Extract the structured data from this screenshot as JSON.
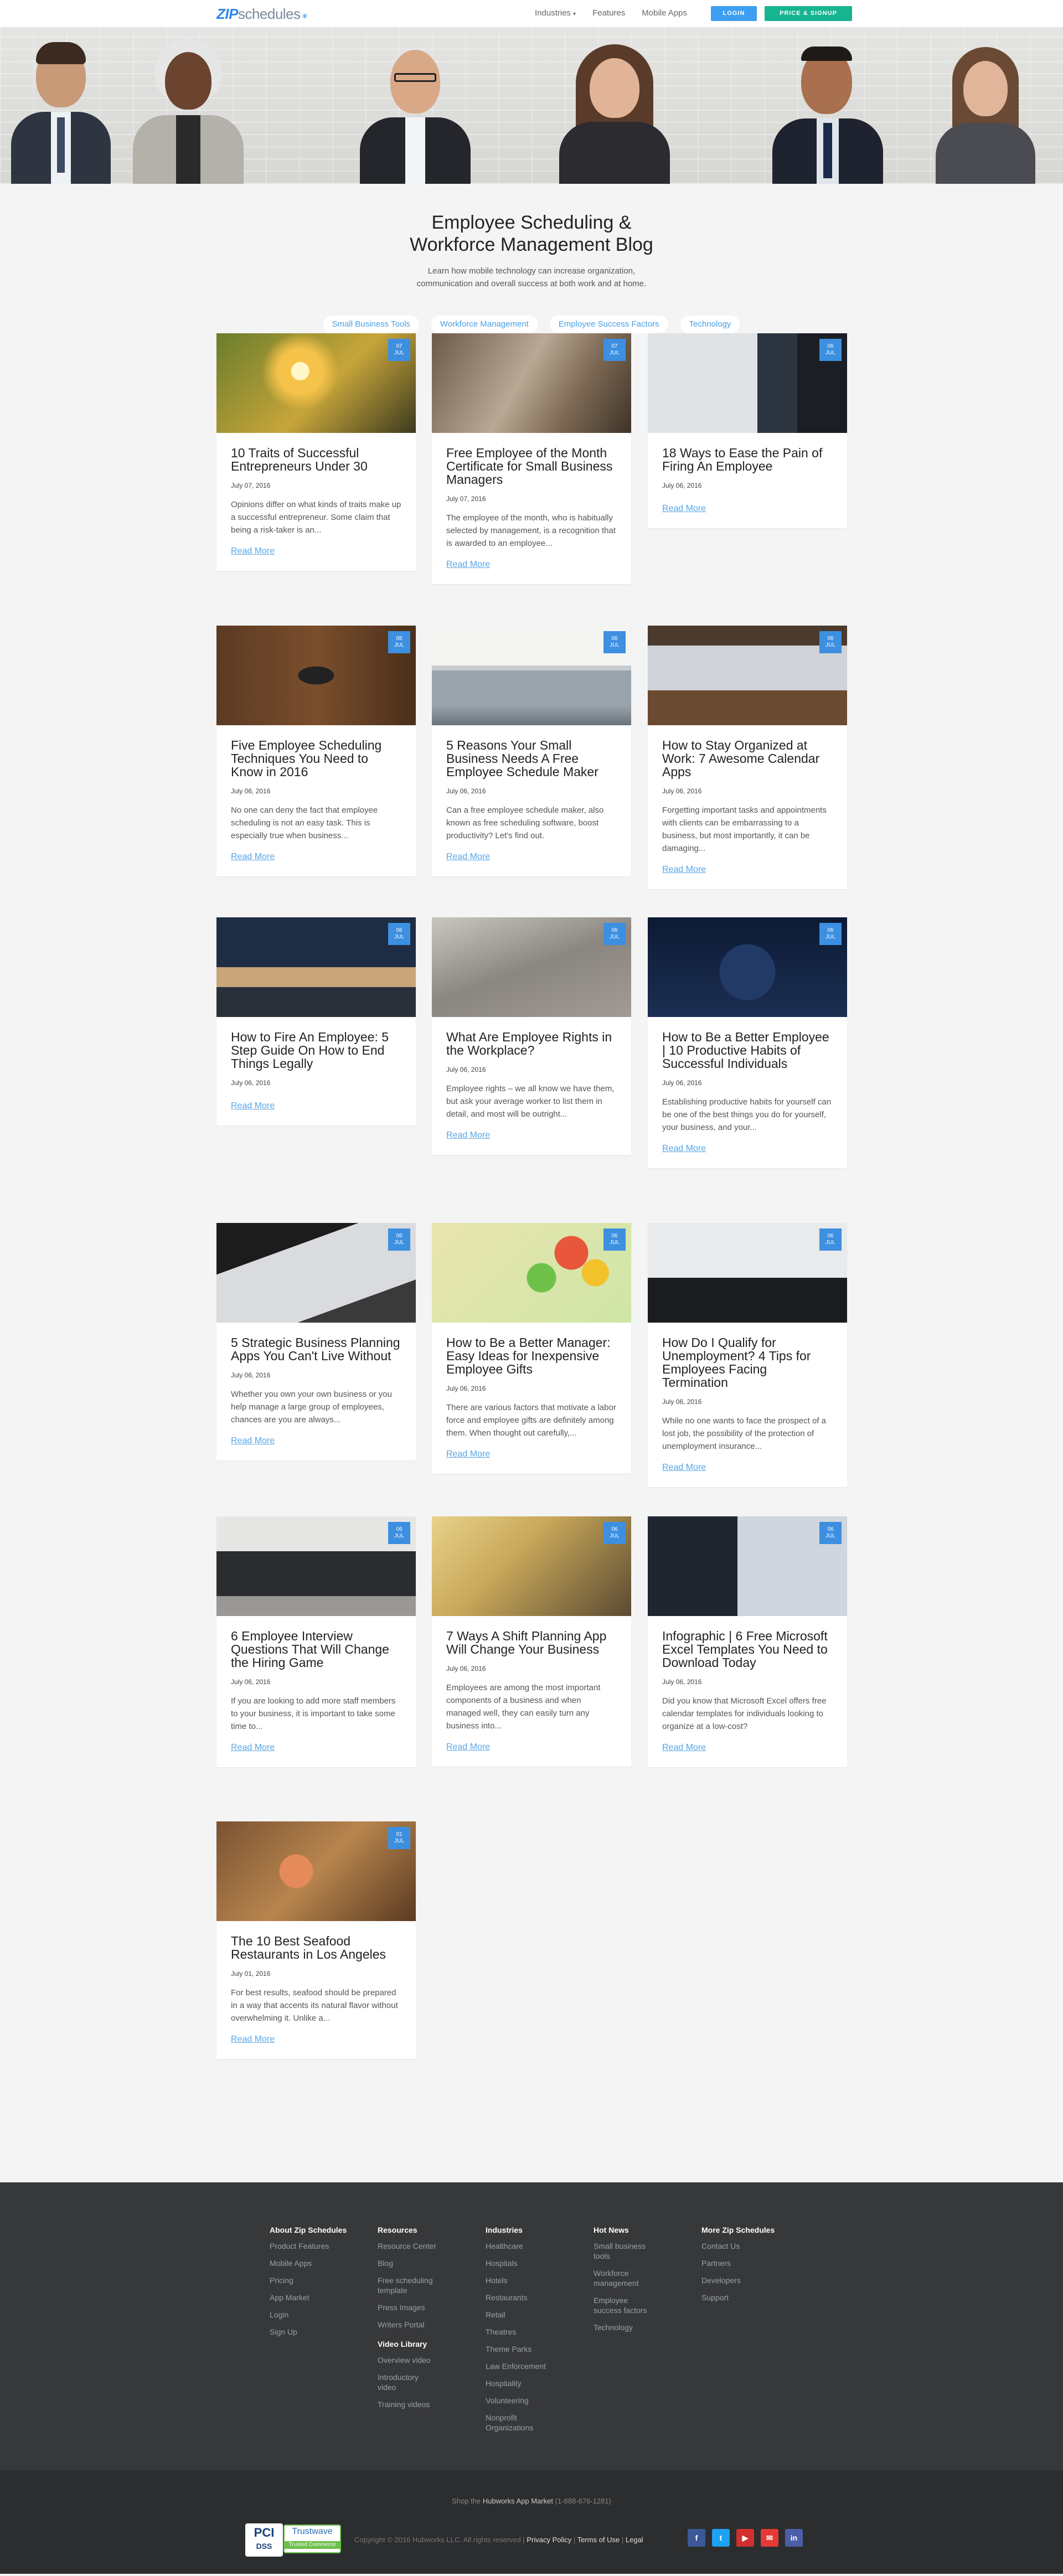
{
  "nav": {
    "logo_zip": "ZIP",
    "logo_sched": "schedules",
    "items": [
      {
        "label": "Industries"
      },
      {
        "label": "Features"
      },
      {
        "label": "Mobile Apps"
      }
    ],
    "login": "LOGIN",
    "price_signup": "PRICE & SIGNUP"
  },
  "intro": {
    "title_line1": "Employee Scheduling &",
    "title_line2": "Workforce Management Blog",
    "desc_line1": "Learn how mobile technology can increase organization,",
    "desc_line2": "communication and overall success at both work and at home."
  },
  "categories": [
    {
      "label": "Small Business Tools"
    },
    {
      "label": "Workforce Management"
    },
    {
      "label": "Employee Success Factors"
    },
    {
      "label": "Technology"
    }
  ],
  "posts": [
    {
      "day": "07",
      "month": "JUL",
      "title": "10 Traits of Successful Entrepreneurs Under 30",
      "date": "July 07, 2016",
      "excerpt": "Opinions differ on what kinds of traits make up a successful entrepreneur. Some claim that being a risk-taker is an...",
      "more": "Read More"
    },
    {
      "day": "07",
      "month": "JUL",
      "title": "Free Employee of the Month Certificate for Small Business Managers",
      "date": "July 07, 2016",
      "excerpt": "The employee of the month, who is habitually selected by management, is a recognition that is awarded to an employee...",
      "more": "Read More"
    },
    {
      "day": "06",
      "month": "JUL",
      "title": "18 Ways to Ease the Pain of Firing An Employee",
      "date": "July 06, 2016",
      "excerpt": "",
      "more": "Read More"
    },
    {
      "day": "06",
      "month": "JUL",
      "title": "Five Employee Scheduling Techniques You Need to Know in 2016",
      "date": "July 06, 2016",
      "excerpt": "No one can deny the fact that employee scheduling is not an easy task. This is especially true when business...",
      "more": "Read More"
    },
    {
      "day": "06",
      "month": "JUL",
      "title": "5 Reasons Your Small Business Needs A Free Employee Schedule Maker",
      "date": "July 06, 2016",
      "excerpt": "Can a free employee schedule maker, also known as free scheduling software, boost productivity? Let's find out.",
      "more": "Read More"
    },
    {
      "day": "06",
      "month": "JUL",
      "title": "How to Stay Organized at Work: 7 Awesome Calendar Apps",
      "date": "July 06, 2016",
      "excerpt": "Forgetting important tasks and appointments with clients can be embarrassing to a business, but most importantly, it can be damaging...",
      "more": "Read More"
    },
    {
      "day": "06",
      "month": "JUL",
      "title": "How to Fire An Employee: 5 Step Guide On How to End Things Legally",
      "date": "July 06, 2016",
      "excerpt": "",
      "more": "Read More"
    },
    {
      "day": "06",
      "month": "JUL",
      "title": "What Are Employee Rights in the Workplace?",
      "date": "July 06, 2016",
      "excerpt": "Employee rights – we all know we have them, but ask your average worker to list them in detail, and most will be outright...",
      "more": "Read More"
    },
    {
      "day": "06",
      "month": "JUL",
      "title": "How to Be a Better Employee | 10 Productive Habits of Successful Individuals",
      "date": "July 06, 2016",
      "excerpt": "Establishing productive habits for yourself can be one of the best things you do for yourself, your business, and your...",
      "more": "Read More"
    },
    {
      "day": "06",
      "month": "JUL",
      "title": "5 Strategic Business Planning Apps You Can't Live Without",
      "date": "July 06, 2016",
      "excerpt": "Whether you own your own business or you help manage a large group of employees, chances are you are always...",
      "more": "Read More"
    },
    {
      "day": "06",
      "month": "JUL",
      "title": "How to Be a Better Manager: Easy Ideas for Inexpensive Employee Gifts",
      "date": "July 06, 2016",
      "excerpt": "There are various factors that motivate a labor force and employee gifts are definitely among them. When thought out carefully,...",
      "more": "Read More"
    },
    {
      "day": "06",
      "month": "JUL",
      "title": "How Do I Qualify for Unemployment? 4 Tips for Employees Facing Termination",
      "date": "July 06, 2016",
      "excerpt": "While no one wants to face the prospect of a lost job, the possibility of the protection of unemployment insurance...",
      "more": "Read More"
    },
    {
      "day": "06",
      "month": "JUL",
      "title": "6 Employee Interview Questions That Will Change the Hiring Game",
      "date": "July 06, 2016",
      "excerpt": "If you are looking to add more staff members to your business, it is important to take some time to...",
      "more": "Read More"
    },
    {
      "day": "06",
      "month": "JUL",
      "title": "7 Ways A Shift Planning App Will Change Your Business",
      "date": "July 06, 2016",
      "excerpt": "Employees are among the most important components of a business and when managed well, they can easily turn any business into...",
      "more": "Read More"
    },
    {
      "day": "06",
      "month": "JUL",
      "title": "Infographic | 6 Free Microsoft Excel Templates You Need to Download Today",
      "date": "July 06, 2016",
      "excerpt": "Did you know that Microsoft Excel offers free calendar templates for individuals looking to organize at a low-cost?",
      "more": "Read More"
    },
    {
      "day": "01",
      "month": "JUL",
      "title": "The 10 Best Seafood Restaurants in Los Angeles",
      "date": "July 01, 2016",
      "excerpt": "For best results, seafood should be prepared in a way that accents its natural flavor without overwhelming it. Unlike a...",
      "more": "Read More"
    }
  ],
  "footer": {
    "columns": [
      {
        "heading": "About Zip Schedules",
        "links": [
          "Product Features",
          "Mobile Apps",
          "Pricing",
          "App Market",
          "Login",
          "Sign Up"
        ]
      },
      {
        "heading": "Resources",
        "links": [
          "Resource Center",
          "Blog",
          "Free scheduling template",
          "Press Images",
          "Writers Portal"
        ],
        "heading2": "Video Library",
        "links2": [
          "Overview video",
          "Introductory video",
          "Training videos"
        ]
      },
      {
        "heading": "Industries",
        "links": [
          "Healthcare",
          "Hospitals",
          "Hotels",
          "Restaurants",
          "Retail",
          "Theatres",
          "Theme Parks",
          "Law Enforcement",
          "Hospitality",
          "Volunteering",
          "Nonprofit Organizations"
        ]
      },
      {
        "heading": "Hot News",
        "links": [
          "Small business tools",
          "Workforce management",
          "Employee success factors",
          "Technology"
        ]
      },
      {
        "heading": "More Zip Schedules",
        "links": [
          "Contact Us",
          "Partners",
          "Developers",
          "Support"
        ]
      }
    ],
    "shop_prefix": "Shop the",
    "shop_link": "Hubworks App Market",
    "shop_phone": "(1-888-676-1281)",
    "copyright": "Copyright © 2016 Hubworks LLC. All rights reserved |",
    "privacy": "Privacy Policy",
    "terms": "Terms of Use",
    "legal": "Legal",
    "pci": "PCI",
    "dss": "DSS",
    "trustwave": "Trustwave",
    "trustwave_sub": "Trusted Commerce",
    "social": [
      "f",
      "t",
      "▶",
      "✉",
      "in"
    ],
    "social_colors": [
      "#3b5998",
      "#1da1f2",
      "#d32f2f",
      "#e53935",
      "#4a5fa8"
    ]
  }
}
